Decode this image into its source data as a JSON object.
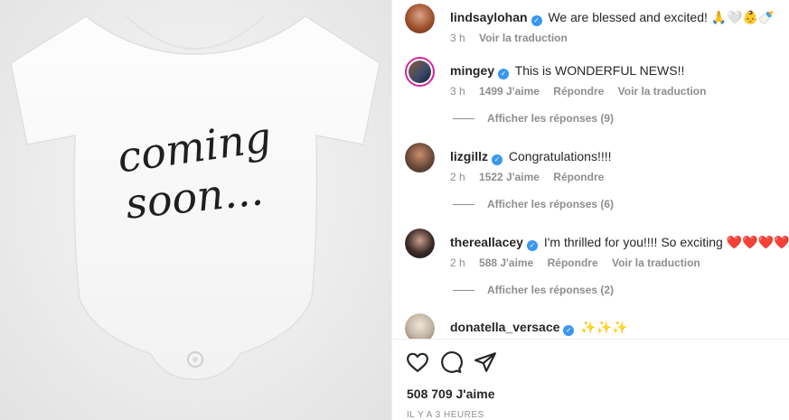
{
  "post_image": {
    "onesie_line1": "coming",
    "onesie_line2": "soon..."
  },
  "caption": {
    "username": "lindsaylohan",
    "text": "We are blessed and excited! 🙏🤍👶🍼",
    "time": "3 h",
    "translate": "Voir la traduction"
  },
  "comments": [
    {
      "username": "mingey",
      "text": "This is WONDERFUL NEWS!!",
      "time": "3 h",
      "likes": "1499 J'aime",
      "reply": "Répondre",
      "translate": "Voir la traduction",
      "view_replies": "Afficher les réponses (9)"
    },
    {
      "username": "lizgillz",
      "text": "Congratulations!!!!",
      "time": "2 h",
      "likes": "1522 J'aime",
      "reply": "Répondre",
      "view_replies": "Afficher les réponses (6)"
    },
    {
      "username": "thereallacey",
      "text": "I'm thrilled for you!!!! So exciting ❤️❤️❤️❤️",
      "time": "2 h",
      "likes": "588 J'aime",
      "reply": "Répondre",
      "translate": "Voir la traduction",
      "view_replies": "Afficher les réponses (2)"
    },
    {
      "username": "donatella_versace",
      "text": "✨✨✨"
    }
  ],
  "footer": {
    "likes": "508 709 J'aime",
    "time_ago": "IL Y A 3 HEURES"
  },
  "icons": {
    "like": "heart-icon",
    "comment": "comment-icon",
    "share": "share-icon",
    "verified": "verified-badge-icon"
  },
  "colors": {
    "verified": "#3897f0",
    "muted": "#8e8e8e",
    "text": "#262626"
  }
}
